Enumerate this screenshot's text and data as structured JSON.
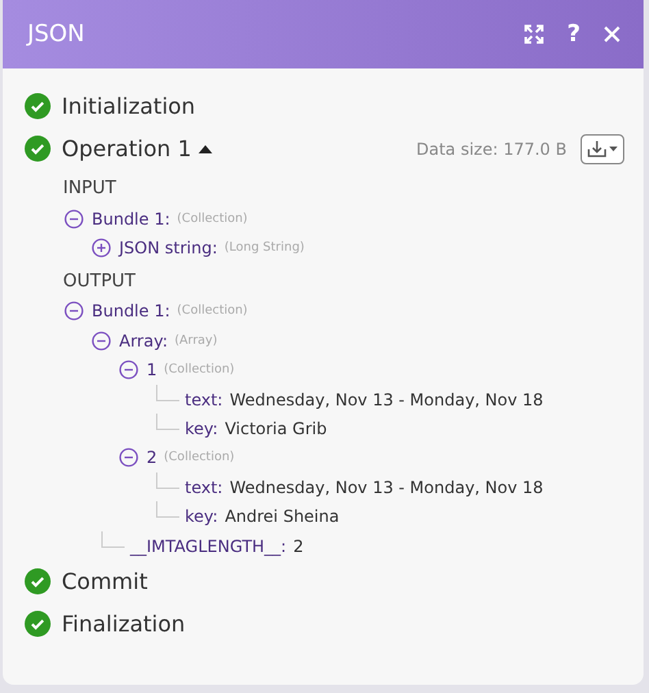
{
  "window": {
    "title": "JSON",
    "help": "?"
  },
  "steps": [
    {
      "label": "Initialization",
      "completed": true
    },
    {
      "label": "Operation 1",
      "completed": true,
      "expanded": true,
      "data_size": "Data size: 177.0 B",
      "sections": [
        {
          "heading": "INPUT",
          "tree": [
            {
              "kind": "node",
              "label": "Bundle 1:",
              "type": "(Collection)",
              "expanded": true,
              "children": [
                {
                  "kind": "node",
                  "label": "JSON string:",
                  "type": "(Long String)",
                  "expanded": false
                }
              ]
            }
          ]
        },
        {
          "heading": "OUTPUT",
          "tree": [
            {
              "kind": "node",
              "label": "Bundle 1:",
              "type": "(Collection)",
              "expanded": true,
              "children": [
                {
                  "kind": "node",
                  "label": "Array:",
                  "type": "(Array)",
                  "expanded": true,
                  "children": [
                    {
                      "kind": "node",
                      "label": "1",
                      "type": "(Collection)",
                      "expanded": true,
                      "children": [
                        {
                          "kind": "leaf",
                          "label": "text:",
                          "value": "Wednesday, Nov 13 - Monday, Nov 18"
                        },
                        {
                          "kind": "leaf",
                          "label": "key:",
                          "value": "Victoria Grib"
                        }
                      ]
                    },
                    {
                      "kind": "node",
                      "label": "2",
                      "type": "(Collection)",
                      "expanded": true,
                      "children": [
                        {
                          "kind": "leaf",
                          "label": "text:",
                          "value": "Wednesday, Nov 13 - Monday, Nov 18"
                        },
                        {
                          "kind": "leaf",
                          "label": "key:",
                          "value": "Andrei Sheina"
                        }
                      ]
                    }
                  ]
                },
                {
                  "kind": "leaf",
                  "label": "__IMTAGLENGTH__:",
                  "value": "2"
                }
              ]
            }
          ]
        }
      ]
    },
    {
      "label": "Commit",
      "completed": true
    },
    {
      "label": "Finalization",
      "completed": true
    }
  ]
}
